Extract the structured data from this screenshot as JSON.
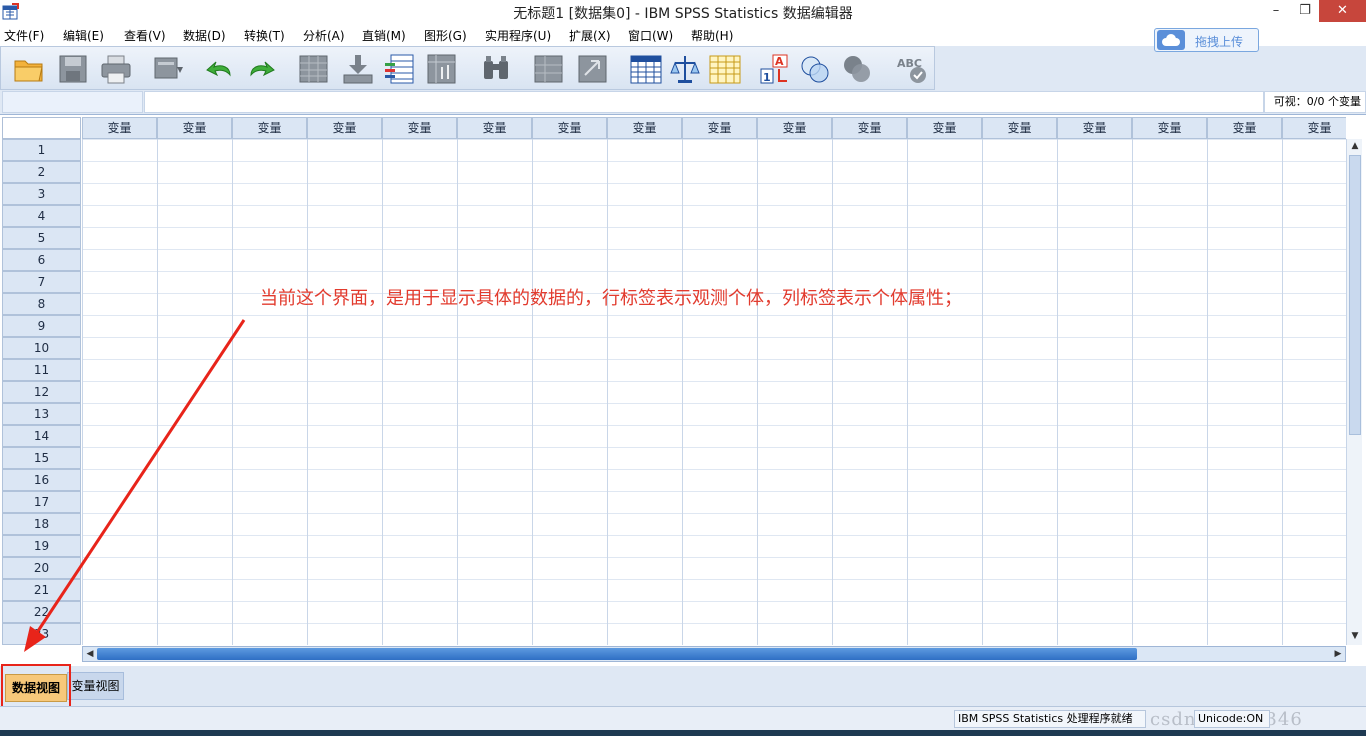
{
  "window": {
    "title": "无标题1 [数据集0] - IBM SPSS Statistics 数据编辑器",
    "minimize": "–",
    "maximize": "❐",
    "close": "✕"
  },
  "menu": [
    {
      "label": "文件(F)",
      "name": "menu-file"
    },
    {
      "label": "编辑(E)",
      "name": "menu-edit"
    },
    {
      "label": "查看(V)",
      "name": "menu-view"
    },
    {
      "label": "数据(D)",
      "name": "menu-data"
    },
    {
      "label": "转换(T)",
      "name": "menu-transform"
    },
    {
      "label": "分析(A)",
      "name": "menu-analyze"
    },
    {
      "label": "直销(M)",
      "name": "menu-direct-marketing"
    },
    {
      "label": "图形(G)",
      "name": "menu-graphs"
    },
    {
      "label": "实用程序(U)",
      "name": "menu-utilities"
    },
    {
      "label": "扩展(X)",
      "name": "menu-extensions"
    },
    {
      "label": "窗口(W)",
      "name": "menu-window"
    },
    {
      "label": "帮助(H)",
      "name": "menu-help"
    }
  ],
  "upload_button": {
    "label": "拖拽上传"
  },
  "toolbar_icons": [
    "open-folder-icon",
    "save-icon",
    "print-icon",
    "dialog-recall-icon",
    "undo-icon",
    "redo-icon",
    "goto-case-icon",
    "goto-variable-icon",
    "variables-icon",
    "run-descriptives-icon",
    "find-icon",
    "insert-cases-icon",
    "insert-variable-icon",
    "table-icon",
    "split-file-icon",
    "weight-cases-icon",
    "select-cases-icon",
    "value-labels-icon",
    "use-sets-icon",
    "show-all-variables-icon",
    "spell-check-icon"
  ],
  "editbar": {
    "cell_name": "",
    "cell_value": "",
    "visible_label": "可视：0/0 个变量"
  },
  "grid": {
    "column_header": "变量",
    "column_count": 17,
    "rows": [
      "1",
      "2",
      "3",
      "4",
      "5",
      "6",
      "7",
      "8",
      "9",
      "10",
      "11",
      "12",
      "13",
      "14",
      "15",
      "16",
      "17",
      "18",
      "19",
      "20",
      "21",
      "22",
      "23"
    ]
  },
  "annotation": {
    "text": "当前这个界面，是用于显示具体的数据的，行标签表示观测个体，列标签表示个体属性；",
    "color": "#e23b2e"
  },
  "tabs": {
    "data_view": "数据视图",
    "variable_view": "变量视图"
  },
  "status": {
    "processor": "IBM SPSS Statistics 处理程序就绪",
    "unicode": "Unicode:ON",
    "watermark": "csdn 39883346"
  }
}
